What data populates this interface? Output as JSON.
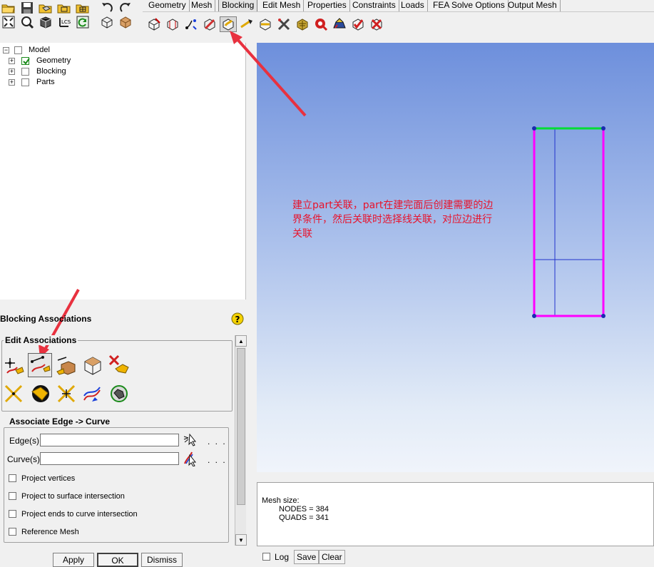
{
  "menu_tabs": [
    {
      "label": "Geometry"
    },
    {
      "label": "Mesh"
    },
    {
      "label": "Blocking",
      "active": true
    },
    {
      "label": "Edit Mesh"
    },
    {
      "label": "Properties"
    },
    {
      "label": "Constraints"
    },
    {
      "label": "Loads"
    },
    {
      "label": "FEA Solve Options"
    },
    {
      "label": "Output Mesh"
    }
  ],
  "main_toolbar": {
    "row1": [
      "open-folder-icon",
      "save-icon",
      "open-geometry-icon",
      "open-blocking-icon",
      "open-mesh-icon",
      "undo-icon",
      "redo-icon"
    ],
    "row2": [
      "fit-window-icon",
      "zoom-box-icon",
      "view-3d-icon",
      "local-coords-icon",
      "refresh-icon",
      "wireframe-icon",
      "solid-shading-icon"
    ],
    "local_coords_label": "LCS"
  },
  "blocking_toolbar": [
    "create-block-icon",
    "split-block-icon",
    "merge-vertices-icon",
    "edit-block-icon",
    "associate-icon",
    "move-vertices-icon",
    "transform-blocks-icon",
    "edit-edge-icon",
    "pre-mesh-params-icon",
    "pre-mesh-quality-icon",
    "pre-mesh-smooth-icon",
    "check-blocks-icon",
    "delete-block-icon"
  ],
  "tree": {
    "root": "Model",
    "children": [
      "Geometry",
      "Blocking",
      "Parts"
    ]
  },
  "annotation": {
    "text": "建立part关联，part在建完面后创建需要的边界条件，然后关联时选择线关联，对应边进行关联",
    "color": "#e8132c"
  },
  "model": {
    "edge_color": "#ff00ff",
    "top_edge_color": "#00dd33",
    "inner_line_color": "#2233cc",
    "vertex_color": "#1a2bb0"
  },
  "panel": {
    "title": "Blocking Associations",
    "edit_group_label": "Edit Associations",
    "assoc_group_label": "Associate Edge -> Curve",
    "edges_label": "Edge(s)",
    "curves_label": "Curve(s)",
    "edges_value": "",
    "curves_value": "",
    "more_label": ". . .",
    "checkboxes": [
      {
        "label": "Project vertices",
        "checked": false
      },
      {
        "label": "Project to surface intersection",
        "checked": false
      },
      {
        "label": "Project ends to curve intersection",
        "checked": false
      },
      {
        "label": "Reference Mesh",
        "checked": false
      }
    ],
    "buttons": {
      "apply": "Apply",
      "ok": "OK",
      "dismiss": "Dismiss"
    }
  },
  "messages": {
    "lines": [
      "Mesh size:",
      "NODES = 384",
      "QUADS = 341"
    ],
    "log_label": "Log",
    "save_label": "Save",
    "clear_label": "Clear"
  },
  "accent_colors": {
    "arrow": "#e8313f"
  }
}
